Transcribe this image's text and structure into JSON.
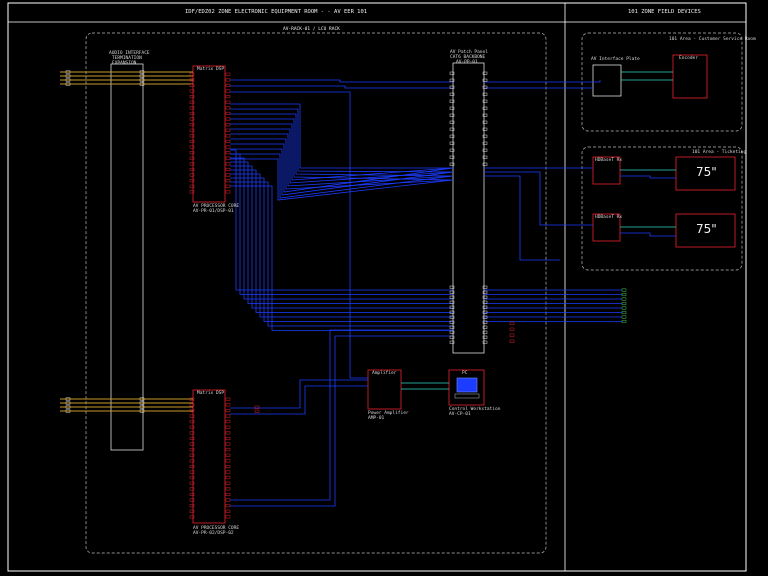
{
  "sheet": {
    "left_title": "IDF/EDZ02 ZONE ELECTRONIC EQUIPMENT ROOM - - AV EER 101",
    "right_title": "101 ZONE FIELD DEVICES"
  },
  "rack": {
    "title": "AV-RACK-01 / LCU RACK",
    "dsp_top": {
      "title": "Matrix DSP",
      "caption": [
        "AV PROCESSOR CORE",
        "AV-PR-01/DSP-01"
      ]
    },
    "dsp_bottom": {
      "title": "Matrix DSP",
      "caption": [
        "AV PROCESSOR CORE",
        "AV-PR-02/DSP-02"
      ]
    },
    "patch_left": {
      "caption": [
        "AUDIO INTERFACE",
        "TERMINATION",
        "EXPANSION"
      ]
    },
    "patch_right": {
      "caption": [
        "AV Patch Panel",
        "CAT6 BACKBONE",
        "AV-PP-01"
      ]
    },
    "amp": {
      "title": "Amplifier",
      "caption": [
        "Power Amplifier",
        "AMP-01"
      ]
    },
    "control_pc": {
      "title": "PC",
      "caption": [
        "Control Workstation",
        "AV-CP-01"
      ]
    }
  },
  "field": {
    "room_one": {
      "title": "101 Area - Customer Service Room",
      "extender": "AV Interface Plate",
      "encoder": "Encoder"
    },
    "room_two": {
      "title": "101 Area - Ticketing",
      "display_size_top": "75\"",
      "display_size_bottom": "75\"",
      "rx_top": "HDBaseT Rx",
      "rx_bottom": "HDBaseT Rx"
    }
  },
  "colors": {
    "frame": "#ffffff",
    "wire": "#1c3cff",
    "audio": "#c89a28",
    "device": "#d0202a",
    "signal": "#2fd6c8",
    "endpoint": "#3fc45a"
  }
}
